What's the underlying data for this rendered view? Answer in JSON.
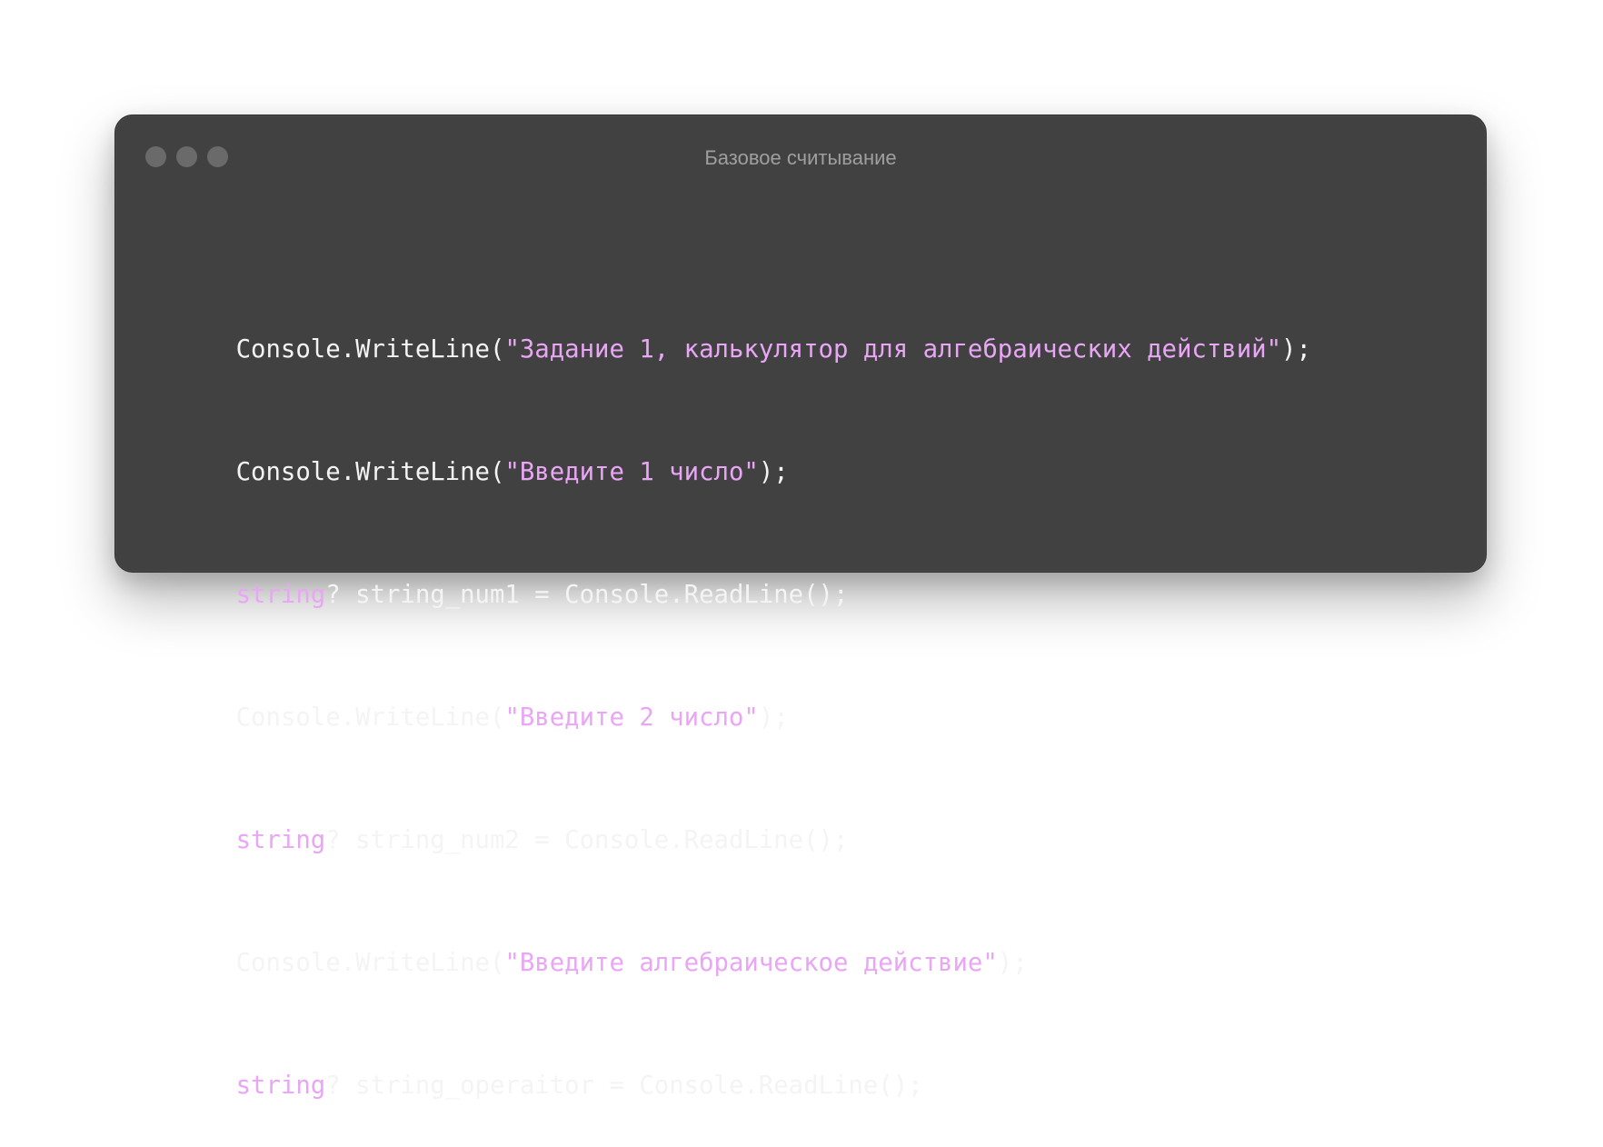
{
  "window": {
    "title": "Базовое считывание"
  },
  "code": {
    "lines": [
      [
        {
          "t": "plain",
          "v": "Console.WriteLine("
        },
        {
          "t": "str",
          "v": "\"Задание 1, калькулятор для алгебраических действий\""
        },
        {
          "t": "plain",
          "v": ");"
        }
      ],
      [
        {
          "t": "plain",
          "v": "Console.WriteLine("
        },
        {
          "t": "str",
          "v": "\"Введите 1 число\""
        },
        {
          "t": "plain",
          "v": ");"
        }
      ],
      [
        {
          "t": "kw",
          "v": "string"
        },
        {
          "t": "plain",
          "v": "? string_num1 = Console.ReadLine();"
        }
      ],
      [
        {
          "t": "plain",
          "v": "Console.WriteLine("
        },
        {
          "t": "str",
          "v": "\"Введите 2 число\""
        },
        {
          "t": "plain",
          "v": ");"
        }
      ],
      [
        {
          "t": "kw",
          "v": "string"
        },
        {
          "t": "plain",
          "v": "? string_num2 = Console.ReadLine();"
        }
      ],
      [
        {
          "t": "plain",
          "v": "Console.WriteLine("
        },
        {
          "t": "str",
          "v": "\"Введите алгебраическое действие\""
        },
        {
          "t": "plain",
          "v": ");"
        }
      ],
      [
        {
          "t": "kw",
          "v": "string"
        },
        {
          "t": "plain",
          "v": "? string_operaitor = Console.ReadLine();"
        }
      ]
    ]
  },
  "colors": {
    "window_bg": "#414141",
    "text": "#f4f4f4",
    "string": "#e9a6f5",
    "keyword": "#e9a6f5",
    "title": "#9f9f9f",
    "traffic_dot": "#6a6a6a"
  },
  "icons": [
    "window-dot-icon",
    "window-dot-icon",
    "window-dot-icon"
  ]
}
